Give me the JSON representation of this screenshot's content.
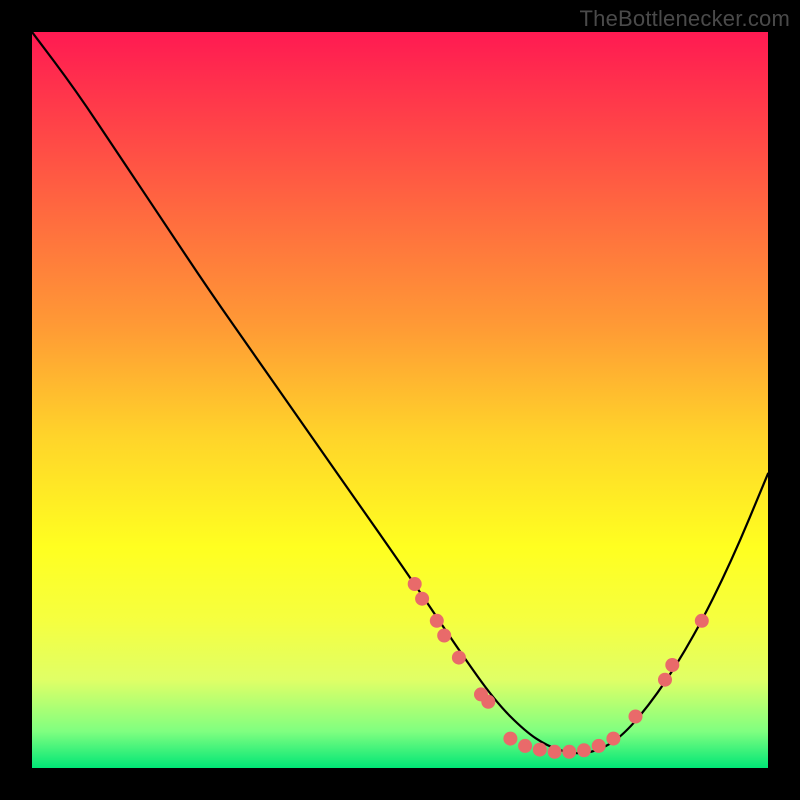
{
  "watermark": "TheBottlenecker.com",
  "colors": {
    "dot": "#e96a6a",
    "curve": "#000000",
    "bg_black": "#000000"
  },
  "chart_data": {
    "type": "line",
    "title": "",
    "xlabel": "",
    "ylabel": "",
    "xlim": [
      0,
      100
    ],
    "ylim": [
      0,
      100
    ],
    "grid": false,
    "series": [
      {
        "name": "bottleneck-curve",
        "x": [
          0,
          6,
          12,
          18,
          24,
          31,
          38,
          45,
          52,
          58,
          63,
          67,
          70,
          73,
          76,
          80,
          85,
          90,
          95,
          100
        ],
        "y": [
          100,
          92,
          83,
          74,
          65,
          55,
          45,
          35,
          25,
          16,
          9,
          5,
          3,
          2,
          2,
          4,
          10,
          18,
          28,
          40
        ]
      }
    ],
    "points": [
      {
        "name": "left-cluster-1",
        "x": 52,
        "y": 25
      },
      {
        "name": "left-cluster-2",
        "x": 53,
        "y": 23
      },
      {
        "name": "left-cluster-3",
        "x": 55,
        "y": 20
      },
      {
        "name": "left-cluster-4",
        "x": 56,
        "y": 18
      },
      {
        "name": "left-cluster-5",
        "x": 58,
        "y": 15
      },
      {
        "name": "left-lower-1",
        "x": 61,
        "y": 10
      },
      {
        "name": "left-lower-2",
        "x": 62,
        "y": 9
      },
      {
        "name": "floor-1",
        "x": 65,
        "y": 4
      },
      {
        "name": "floor-2",
        "x": 67,
        "y": 3
      },
      {
        "name": "floor-3",
        "x": 69,
        "y": 2.5
      },
      {
        "name": "floor-4",
        "x": 71,
        "y": 2.2
      },
      {
        "name": "floor-5",
        "x": 73,
        "y": 2.2
      },
      {
        "name": "floor-6",
        "x": 75,
        "y": 2.4
      },
      {
        "name": "floor-7",
        "x": 77,
        "y": 3
      },
      {
        "name": "floor-8",
        "x": 79,
        "y": 4
      },
      {
        "name": "right-lower-1",
        "x": 82,
        "y": 7
      },
      {
        "name": "right-upper-1",
        "x": 86,
        "y": 12
      },
      {
        "name": "right-upper-2",
        "x": 87,
        "y": 14
      },
      {
        "name": "right-top",
        "x": 91,
        "y": 20
      }
    ]
  }
}
